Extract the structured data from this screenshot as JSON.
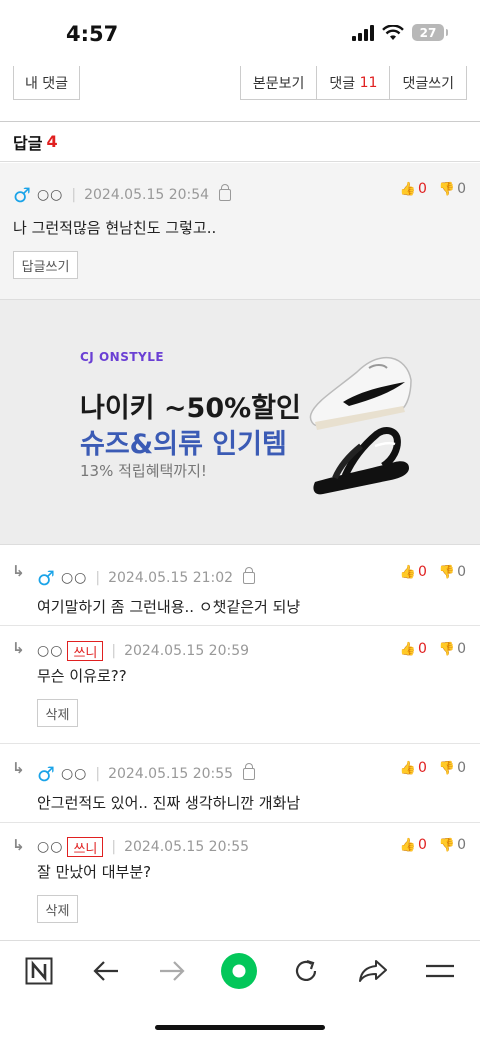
{
  "status": {
    "time": "4:57",
    "battery": "27"
  },
  "tabs": {
    "my_comments": "내 댓글",
    "view_post": "본문보기",
    "comments_label": "댓글",
    "comments_count": "11",
    "write_comment": "댓글쓰기"
  },
  "replies": {
    "label": "답글",
    "count": "4"
  },
  "comments": [
    {
      "nick": "○○",
      "date": "2024.05.15 20:54",
      "text": "나 그런적많음 현남친도 그렇고..",
      "up": "0",
      "down": "0",
      "button": "답글쓰기"
    },
    {
      "nick": "○○",
      "date": "2024.05.15 21:02",
      "text": "여기말하기 좀 그런내용.. ㅇ챗같은거 되냥",
      "up": "0",
      "down": "0"
    },
    {
      "nick": "○○",
      "badge": "쓰니",
      "date": "2024.05.15 20:59",
      "text": "무슨 이유로??",
      "up": "0",
      "down": "0",
      "button": "삭제"
    },
    {
      "nick": "○○",
      "date": "2024.05.15 20:55",
      "text": "안그런적도 있어.. 진짜 생각하니깐 개화남",
      "up": "0",
      "down": "0"
    },
    {
      "nick": "○○",
      "badge": "쓰니",
      "date": "2024.05.15 20:55",
      "text": "잘 만났어 대부분?",
      "up": "0",
      "down": "0",
      "button": "삭제"
    }
  ],
  "ad": {
    "brand": "CJ ONSTYLE",
    "title1": "나이키 ~50%할인",
    "title2": "슈즈&의류 인기템",
    "subtitle": "13% 적립혜택까지!"
  },
  "nav": {
    "icons": [
      "naver-n-icon",
      "back-arrow-icon",
      "forward-arrow-icon",
      "green-dot-icon",
      "refresh-icon",
      "share-icon",
      "menu-icon"
    ]
  },
  "colors": {
    "accent_red": "#e02020",
    "male_blue": "#1aa3e8",
    "green": "#03c75a"
  }
}
